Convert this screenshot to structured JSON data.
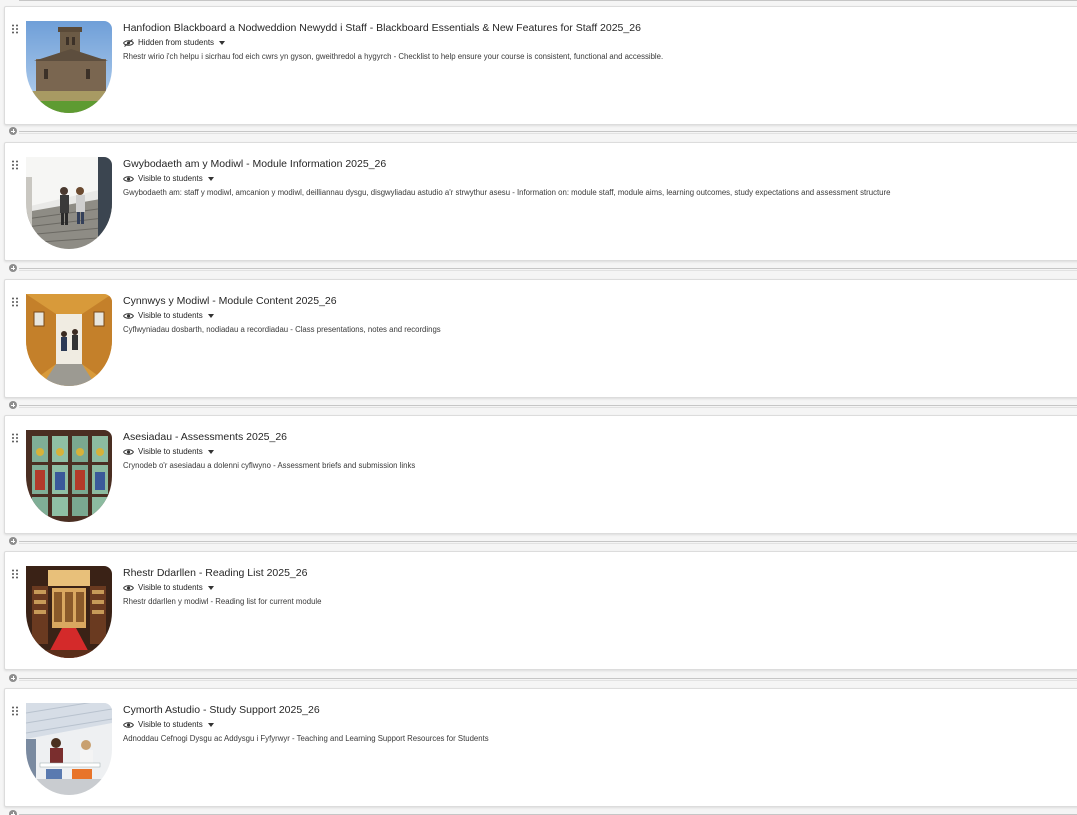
{
  "modules": [
    {
      "title": "Hanfodion Blackboard a Nodweddion Newydd i Staff - Blackboard Essentials & New Features for Staff 2025_26",
      "visibility": "Hidden from students",
      "visibility_icon": "eye-slash-icon",
      "description": "Rhestr wirio i'ch helpu i sicrhau fod eich cwrs yn gyson, gweithredol a hygyrch - Checklist to help ensure your course is consistent, functional and accessible.",
      "image": "castle-building-image"
    },
    {
      "title": "Gwybodaeth am y Modiwl - Module Information 2025_26",
      "visibility": "Visible to students",
      "visibility_icon": "eye-icon",
      "description": "Gwybodaeth am: staff y modiwl, amcanion y modiwl, deilliannau dysgu, disgwyliadau astudio a'r strwythur asesu - Information on: module staff, module aims, learning outcomes, study expectations and assessment structure",
      "image": "students-on-stairs-image"
    },
    {
      "title": "Cynnwys y Modiwl - Module Content 2025_26",
      "visibility": "Visible to students",
      "visibility_icon": "eye-icon",
      "description": "Cyflwyniadau dosbarth, nodiadau a recordiadau - Class presentations, notes and recordings",
      "image": "wooden-corridor-image"
    },
    {
      "title": "Asesiadau - Assessments 2025_26",
      "visibility": "Visible to students",
      "visibility_icon": "eye-icon",
      "description": "Crynodeb o'r asesiadau a dolenni cyflwyno - Assessment briefs and submission links",
      "image": "stained-glass-image"
    },
    {
      "title": "Rhestr Ddarllen - Reading List 2025_26",
      "visibility": "Visible to students",
      "visibility_icon": "eye-icon",
      "description": "Rhestr ddarllen y modiwl - Reading list for current module",
      "image": "library-interior-image"
    },
    {
      "title": "Cymorth Astudio - Study Support 2025_26",
      "visibility": "Visible to students",
      "visibility_icon": "eye-icon",
      "description": "Adnoddau Cefnogi Dysgu ac Addysgu i Fyfyrwyr - Teaching and Learning Support Resources for Students",
      "image": "study-space-image"
    }
  ],
  "colors": {
    "page_background": "#f5f5f5",
    "card_background": "#ffffff",
    "divider": "#c6c6c6",
    "text": "#262626"
  }
}
